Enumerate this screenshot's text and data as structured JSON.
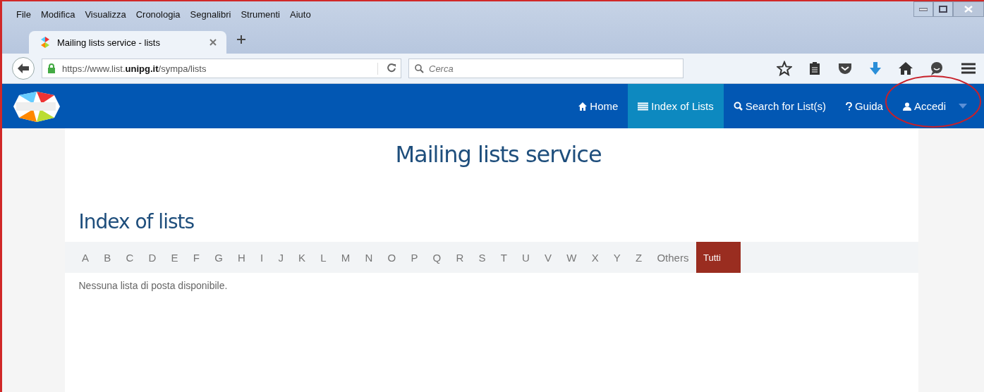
{
  "menu_bar": [
    "File",
    "Modifica",
    "Visualizza",
    "Cronologia",
    "Segnalibri",
    "Strumenti",
    "Aiuto"
  ],
  "tabs": [
    {
      "label": "Mailing lists service - lists",
      "selected": true
    }
  ],
  "address_bar": {
    "url_prefix": "https://www.list.",
    "url_domain": "unipg.it",
    "url_path": "/sympa/lists"
  },
  "search": {
    "placeholder": "Cerca"
  },
  "site_nav": [
    {
      "label": "Home",
      "kind": "home",
      "selected": false
    },
    {
      "label": "Index of Lists",
      "kind": "list",
      "selected": true
    },
    {
      "label": "Search for List(s)",
      "kind": "search",
      "selected": false
    },
    {
      "label": "Guida",
      "kind": "help",
      "selected": false
    },
    {
      "label": "Accedi",
      "kind": "user",
      "selected": false
    }
  ],
  "page_title": "Mailing lists service",
  "section_title": "Index of lists",
  "letters": [
    {
      "label": "A",
      "selected": false
    },
    {
      "label": "B",
      "selected": false
    },
    {
      "label": "C",
      "selected": false
    },
    {
      "label": "D",
      "selected": false
    },
    {
      "label": "E",
      "selected": false
    },
    {
      "label": "F",
      "selected": false
    },
    {
      "label": "G",
      "selected": false
    },
    {
      "label": "H",
      "selected": false
    },
    {
      "label": "I",
      "selected": false
    },
    {
      "label": "J",
      "selected": false
    },
    {
      "label": "K",
      "selected": false
    },
    {
      "label": "L",
      "selected": false
    },
    {
      "label": "M",
      "selected": false
    },
    {
      "label": "N",
      "selected": false
    },
    {
      "label": "O",
      "selected": false
    },
    {
      "label": "P",
      "selected": false
    },
    {
      "label": "Q",
      "selected": false
    },
    {
      "label": "R",
      "selected": false
    },
    {
      "label": "S",
      "selected": false
    },
    {
      "label": "T",
      "selected": false
    },
    {
      "label": "U",
      "selected": false
    },
    {
      "label": "V",
      "selected": false
    },
    {
      "label": "W",
      "selected": false
    },
    {
      "label": "X",
      "selected": false
    },
    {
      "label": "Y",
      "selected": false
    },
    {
      "label": "Z",
      "selected": false
    },
    {
      "label": "Others",
      "selected": false
    },
    {
      "label": "Tutti",
      "selected": true
    }
  ],
  "message": "Nessuna lista di posta disponibile."
}
